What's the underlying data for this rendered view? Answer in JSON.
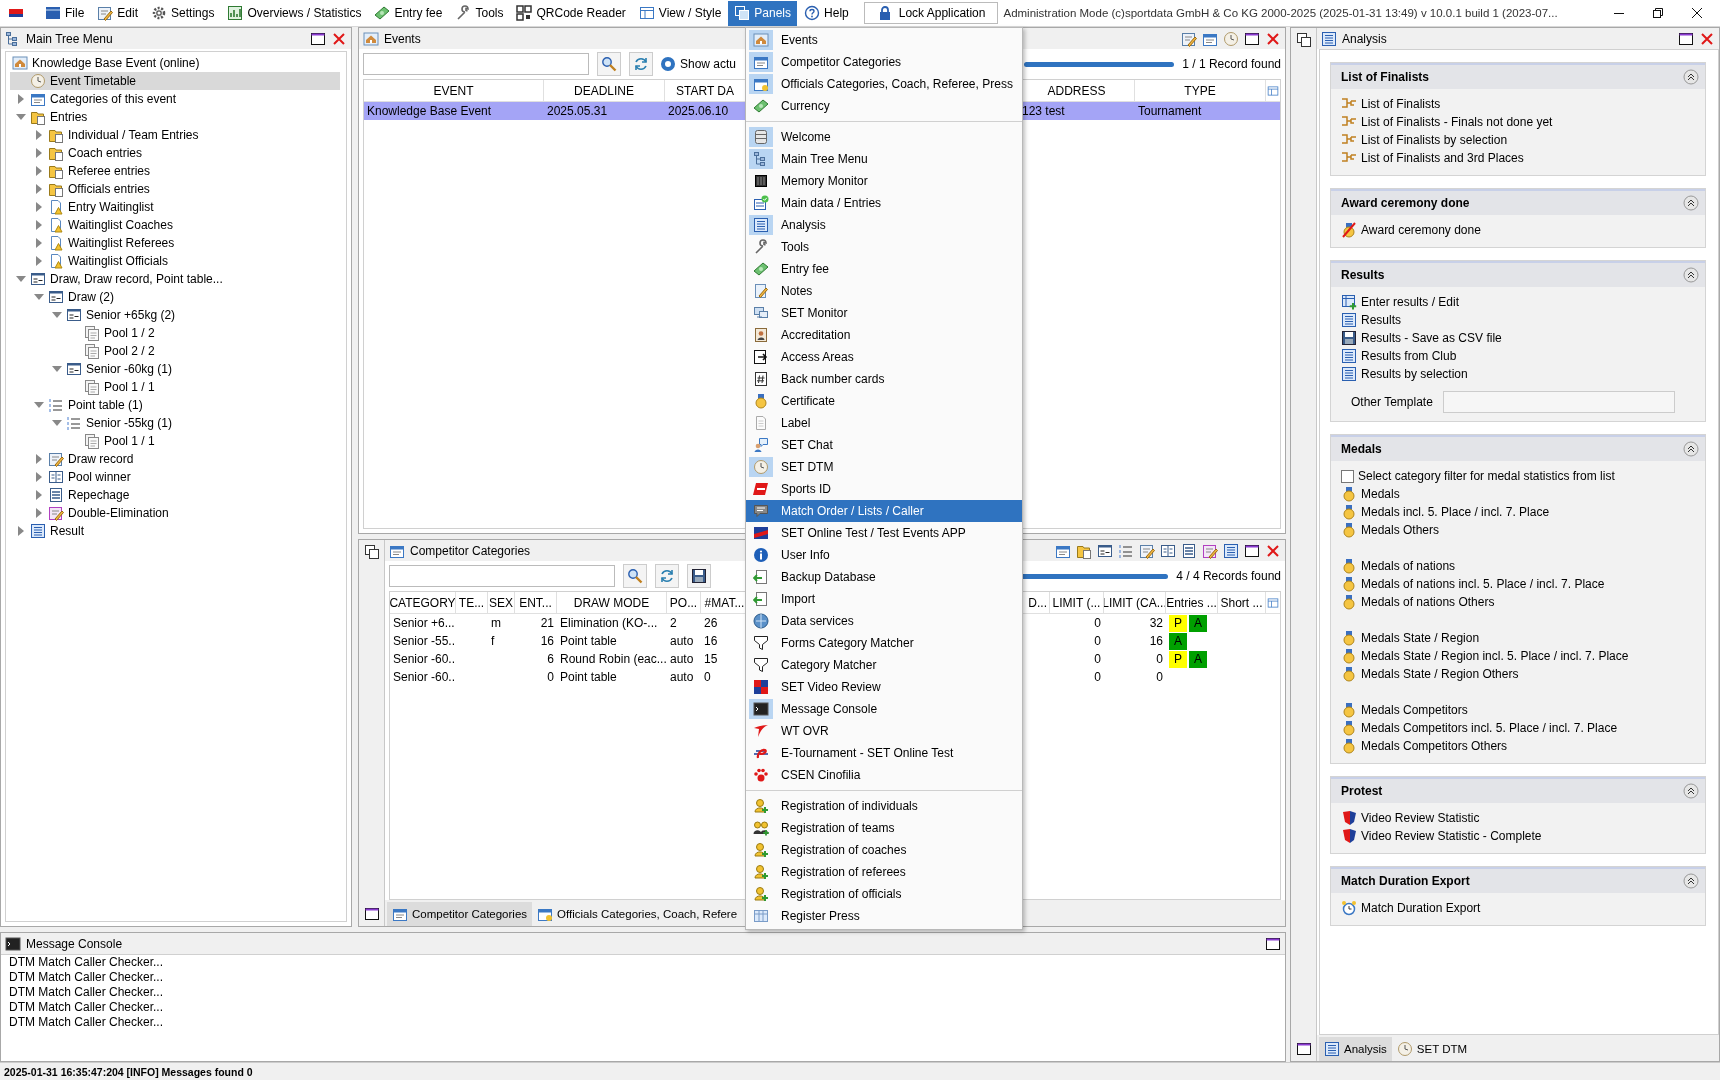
{
  "menu_bar": {
    "items": [
      {
        "label": "File",
        "selected": false
      },
      {
        "label": "Edit",
        "selected": false
      },
      {
        "label": "Settings",
        "selected": false
      },
      {
        "label": "Overviews / Statistics",
        "selected": false
      },
      {
        "label": "Entry fee",
        "selected": false
      },
      {
        "label": "Tools",
        "selected": false
      },
      {
        "label": "QRCode Reader",
        "selected": false
      },
      {
        "label": "View / Style",
        "selected": false
      },
      {
        "label": "Panels",
        "selected": true
      },
      {
        "label": "Help",
        "selected": false
      }
    ],
    "lock_button": "Lock Application",
    "info": "Administration Mode (c)sportdata GmbH & Co KG 2000-2025 (2025-01-31 13:49)  v 10.0.1 build 1 (2023-07..."
  },
  "tree_panel": {
    "title": "Main Tree Menu",
    "root": "Knowledge Base Event (online)",
    "items": [
      {
        "label": "Event Timetable",
        "kind": "timetable",
        "selected": true
      },
      {
        "label": "Categories of this event",
        "kind": "categories",
        "selected": false,
        "expanded": false
      },
      {
        "label": "Entries",
        "kind": "entries",
        "selected": false,
        "expanded": true,
        "children": [
          {
            "label": "Individual / Team Entries",
            "kind": "entries",
            "selected": false,
            "expanded": false
          },
          {
            "label": "Coach entries",
            "kind": "entries",
            "selected": false,
            "expanded": false
          },
          {
            "label": "Referee entries",
            "kind": "entries",
            "selected": false,
            "expanded": false
          },
          {
            "label": "Officials entries",
            "kind": "entries",
            "selected": false,
            "expanded": false
          },
          {
            "label": "Entry Waitinglist",
            "kind": "waitinglist",
            "selected": false,
            "expanded": false
          },
          {
            "label": "Waitinglist Coaches",
            "kind": "waitinglist",
            "selected": false,
            "expanded": false
          },
          {
            "label": "Waitinglist Referees",
            "kind": "waitinglist",
            "selected": false,
            "expanded": false
          },
          {
            "label": "Waitinglist Officials",
            "kind": "waitinglist",
            "selected": false,
            "expanded": false
          }
        ]
      },
      {
        "label": "Draw, Draw record, Point table...",
        "kind": "draw",
        "selected": false,
        "expanded": true,
        "children": [
          {
            "label": "Draw (2)",
            "kind": "draw",
            "selected": false,
            "expanded": true,
            "children": [
              {
                "label": "Senior +65kg (2)",
                "kind": "draw",
                "selected": false,
                "expanded": true,
                "children": [
                  {
                    "label": "Pool 1 / 2",
                    "kind": "pool",
                    "selected": false
                  },
                  {
                    "label": "Pool 2 / 2",
                    "kind": "pool",
                    "selected": false
                  }
                ]
              },
              {
                "label": "Senior -60kg (1)",
                "kind": "draw",
                "selected": false,
                "expanded": true,
                "children": [
                  {
                    "label": "Pool 1 / 1",
                    "kind": "pool",
                    "selected": false
                  }
                ]
              }
            ]
          },
          {
            "label": "Point table (1)",
            "kind": "point_table",
            "selected": false,
            "expanded": true,
            "children": [
              {
                "label": "Senior -55kg (1)",
                "kind": "point_table",
                "selected": false,
                "expanded": true,
                "children": [
                  {
                    "label": "Pool 1 / 1",
                    "kind": "pool",
                    "selected": false
                  }
                ]
              }
            ]
          },
          {
            "label": "Draw record",
            "kind": "draw_record",
            "selected": false,
            "expanded": false
          },
          {
            "label": "Pool winner",
            "kind": "pool_winner",
            "selected": false,
            "expanded": false
          },
          {
            "label": "Repechage",
            "kind": "repechage",
            "selected": false,
            "expanded": false
          },
          {
            "label": "Double-Elimination",
            "kind": "double_elimination",
            "selected": false,
            "expanded": false
          }
        ]
      },
      {
        "label": "Result",
        "kind": "result",
        "selected": false,
        "expanded": false
      }
    ]
  },
  "events_panel": {
    "title": "Events",
    "show_option": {
      "label": "Show actu",
      "selected": true
    },
    "progress": {
      "level": 1
    },
    "record_count": "1 / 1 Record found",
    "columns": [
      "EVENT",
      "DEADLINE",
      "START DA",
      "ADDRESS",
      "TYPE"
    ],
    "rows": [
      {
        "cells": [
          "Knowledge Base Event",
          "2025.05.31",
          "2025.06.10",
          "123 test",
          "Tournament"
        ],
        "selected": true
      }
    ]
  },
  "categories_panel": {
    "title": "Competitor Categories",
    "progress": {
      "level": 1
    },
    "record_count": "4 / 4 Records found",
    "columns": [
      "CATEGORY",
      "TE...",
      "SEX",
      "ENT...",
      "DRAW MODE",
      "PO...",
      "#MAT...",
      "D...",
      "LIMIT (...",
      "LIMIT (CA...",
      "Entries ...",
      "Short ..."
    ],
    "rows": [
      {
        "cells": [
          "Senior +6...",
          null,
          "m",
          "21",
          "Elimination (KO-...",
          "2",
          "26",
          null,
          "0",
          "32"
        ],
        "entries": [
          {
            "text": "P",
            "color": "#ffff00"
          },
          {
            "text": "A",
            "color": "#00a000"
          }
        ]
      },
      {
        "cells": [
          "Senior -55...",
          null,
          "f",
          "16",
          "Point table",
          "auto",
          "16",
          null,
          "0",
          "16"
        ],
        "entries": [
          {
            "text": "A",
            "color": "#00a000"
          }
        ]
      },
      {
        "cells": [
          "Senior -60...",
          null,
          null,
          "6",
          "Round Robin (eac...",
          "auto",
          "15",
          null,
          "0",
          "0"
        ],
        "entries": [
          {
            "text": "P",
            "color": "#ffff00"
          },
          {
            "text": "A",
            "color": "#00a000"
          }
        ]
      },
      {
        "cells": [
          "Senior -60...",
          null,
          null,
          "0",
          "Point table",
          "auto",
          "0",
          null,
          "0",
          "0"
        ]
      }
    ],
    "tabs": [
      {
        "label": "Competitor Categories",
        "selected": true
      },
      {
        "label": "Officials Categories, Coach, Refere",
        "selected": false
      }
    ]
  },
  "message_console": {
    "title": "Message Console",
    "lines": [
      "DTM Match Caller Checker...",
      "DTM Match Caller Checker...",
      "DTM Match Caller Checker...",
      "DTM Match Caller Checker...",
      "DTM Match Caller Checker..."
    ]
  },
  "analysis_panel": {
    "title": "Analysis",
    "sections": [
      {
        "title": "List of Finalists",
        "groups": [
          [
            {
              "kind": "finalist",
              "label": "List of Finalists"
            },
            {
              "kind": "finalist",
              "label": "List of Finalists - Finals not done yet"
            },
            {
              "kind": "finalist",
              "label": "List of Finalists by selection"
            },
            {
              "kind": "finalist",
              "label": "List of Finalists and 3rd Places"
            }
          ]
        ]
      },
      {
        "title": "Award ceremony done",
        "groups": [
          [
            {
              "kind": "award",
              "label": "Award ceremony done"
            }
          ]
        ]
      },
      {
        "title": "Results",
        "groups": [
          [
            {
              "kind": "enter_results",
              "label": "Enter results / Edit"
            },
            {
              "kind": "results",
              "label": "Results"
            },
            {
              "kind": "csv",
              "label": "Results - Save as CSV file"
            },
            {
              "kind": "results",
              "label": "Results from Club"
            },
            {
              "kind": "results",
              "label": "Results by selection"
            }
          ]
        ],
        "field": {
          "label": "Other Template"
        }
      },
      {
        "title": "Medals",
        "groups": [
          [
            {
              "kind": "checkbox",
              "label": "Select category filter for medal statistics from list",
              "checked": false
            },
            {
              "kind": "medal",
              "label": "Medals"
            },
            {
              "kind": "medal",
              "label": "Medals incl. 5. Place / incl. 7. Place"
            },
            {
              "kind": "medal",
              "label": "Medals Others"
            }
          ],
          [
            {
              "kind": "medal",
              "label": "Medals of nations"
            },
            {
              "kind": "medal",
              "label": "Medals of nations incl. 5. Place / incl. 7. Place"
            },
            {
              "kind": "medal",
              "label": "Medals of nations Others"
            }
          ],
          [
            {
              "kind": "medal",
              "label": "Medals State / Region"
            },
            {
              "kind": "medal",
              "label": "Medals State / Region incl. 5. Place / incl. 7. Place"
            },
            {
              "kind": "medal",
              "label": "Medals State / Region Others"
            }
          ],
          [
            {
              "kind": "medal",
              "label": "Medals Competitors"
            },
            {
              "kind": "medal",
              "label": "Medals Competitors incl. 5. Place / incl. 7. Place"
            },
            {
              "kind": "medal",
              "label": "Medals Competitors Others"
            }
          ]
        ]
      },
      {
        "title": "Protest",
        "groups": [
          [
            {
              "kind": "video_review",
              "label": "Video Review Statistic"
            },
            {
              "kind": "video_review",
              "label": "Video Review Statistic - Complete"
            }
          ]
        ]
      },
      {
        "title": "Match Duration Export",
        "groups": [
          [
            {
              "kind": "duration",
              "label": "Match Duration Export"
            }
          ]
        ]
      }
    ],
    "tabs": [
      {
        "label": "Analysis",
        "selected": true
      },
      {
        "label": "SET DTM",
        "selected": false
      }
    ]
  },
  "panels_menu": {
    "groups": [
      [
        {
          "label": "Events",
          "checked": true,
          "selected": false
        },
        {
          "label": "Competitor Categories",
          "checked": true,
          "selected": false
        },
        {
          "label": "Officials Categories, Coach, Referee, Press",
          "checked": true,
          "selected": false
        },
        {
          "label": "Currency",
          "checked": false,
          "selected": false
        }
      ],
      [
        {
          "label": "Welcome",
          "checked": true,
          "selected": false
        },
        {
          "label": "Main Tree Menu",
          "checked": true,
          "selected": false
        },
        {
          "label": "Memory Monitor",
          "checked": false,
          "selected": false
        },
        {
          "label": "Main data / Entries",
          "checked": false,
          "selected": false
        },
        {
          "label": "Analysis",
          "checked": true,
          "selected": false
        },
        {
          "label": "Tools",
          "checked": false,
          "selected": false
        },
        {
          "label": "Entry fee",
          "checked": false,
          "selected": false
        },
        {
          "label": "Notes",
          "checked": false,
          "selected": false
        },
        {
          "label": "SET Monitor",
          "checked": false,
          "selected": false
        },
        {
          "label": "Accreditation",
          "checked": false,
          "selected": false
        },
        {
          "label": "Access Areas",
          "checked": false,
          "selected": false
        },
        {
          "label": "Back number cards",
          "checked": false,
          "selected": false
        },
        {
          "label": "Certificate",
          "checked": false,
          "selected": false
        },
        {
          "label": "Label",
          "checked": false,
          "selected": false
        },
        {
          "label": "SET Chat",
          "checked": false,
          "selected": false
        },
        {
          "label": "SET DTM",
          "checked": true,
          "selected": false
        },
        {
          "label": "Sports ID",
          "checked": false,
          "selected": false
        },
        {
          "label": "Match Order / Lists / Caller",
          "checked": false,
          "selected": true
        },
        {
          "label": "SET Online Test / Test Events APP",
          "checked": false,
          "selected": false
        },
        {
          "label": "User Info",
          "checked": false,
          "selected": false
        },
        {
          "label": "Backup Database",
          "checked": false,
          "selected": false
        },
        {
          "label": "Import",
          "checked": false,
          "selected": false
        },
        {
          "label": "Data services",
          "checked": false,
          "selected": false
        },
        {
          "label": "Forms Category Matcher",
          "checked": false,
          "selected": false
        },
        {
          "label": "Category Matcher",
          "checked": false,
          "selected": false
        },
        {
          "label": "SET Video Review",
          "checked": false,
          "selected": false
        },
        {
          "label": "Message Console",
          "checked": true,
          "selected": false
        },
        {
          "label": "WT OVR",
          "checked": false,
          "selected": false
        },
        {
          "label": "E-Tournament - SET Online Test",
          "checked": false,
          "selected": false
        },
        {
          "label": "CSEN Cinofilia",
          "checked": false,
          "selected": false
        }
      ],
      [
        {
          "label": "Registration of individuals",
          "checked": false,
          "selected": false
        },
        {
          "label": "Registration of teams",
          "checked": false,
          "selected": false
        },
        {
          "label": "Registration of coaches",
          "checked": false,
          "selected": false
        },
        {
          "label": "Registration of referees",
          "checked": false,
          "selected": false
        },
        {
          "label": "Registration of officials",
          "checked": false,
          "selected": false
        },
        {
          "label": "Register Press",
          "checked": false,
          "selected": false
        }
      ]
    ]
  },
  "status_bar": {
    "text": "2025-01-31 16:35:47:204 [INFO] Messages found 0"
  }
}
